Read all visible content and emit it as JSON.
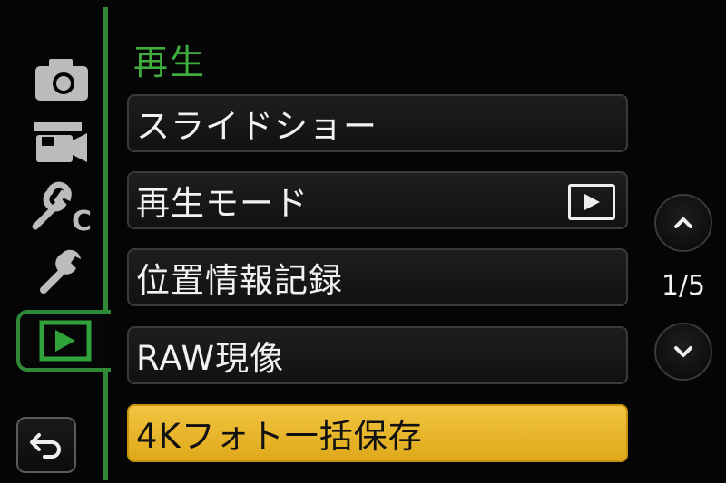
{
  "menu": {
    "title": "再生",
    "items": [
      {
        "label": "スライドショー"
      },
      {
        "label": "再生モード",
        "icon": "playback-mode-icon"
      },
      {
        "label": "位置情報記録"
      },
      {
        "label": "RAW現像"
      },
      {
        "label": "4Kフォト一括保存",
        "selected": true
      }
    ]
  },
  "sidebar": {
    "tabs": [
      {
        "icon": "camera-icon"
      },
      {
        "icon": "video-camera-icon"
      },
      {
        "icon": "custom-wrench-icon"
      },
      {
        "icon": "wrench-icon"
      },
      {
        "icon": "playback-icon",
        "active": true
      }
    ],
    "back_icon": "back-arrow-icon"
  },
  "pagination": {
    "page": "1/5",
    "up_icon": "chevron-up-icon",
    "down_icon": "chevron-down-icon"
  },
  "colors": {
    "accent": "#2f8a37",
    "title": "#3fae3f",
    "selected": "#e9b52c"
  }
}
